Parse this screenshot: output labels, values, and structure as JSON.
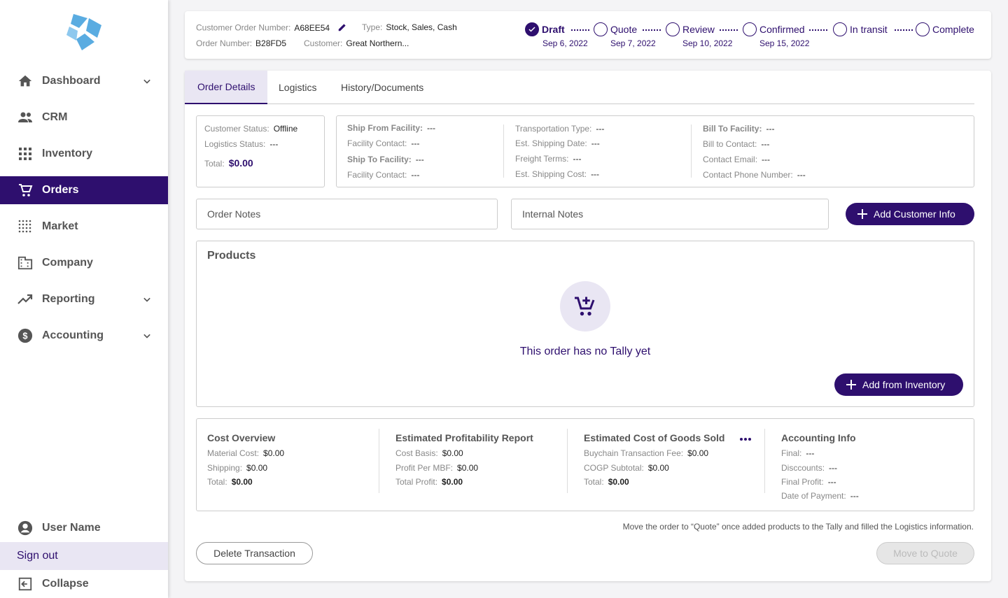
{
  "colors": {
    "brand": "#2e0f6e",
    "accent_bg": "#e9e6f3",
    "logo": "#5aace1"
  },
  "sidebar": {
    "items": [
      {
        "label": "Dashboard",
        "icon": "home-icon",
        "has_chevron": true
      },
      {
        "label": "CRM",
        "icon": "people-icon",
        "has_chevron": false
      },
      {
        "label": "Inventory",
        "icon": "grid-icon",
        "has_chevron": false
      },
      {
        "label": "Orders",
        "icon": "cart-icon",
        "has_chevron": false,
        "active": true
      },
      {
        "label": "Market",
        "icon": "dotgrid-icon",
        "has_chevron": false
      },
      {
        "label": "Company",
        "icon": "building-icon",
        "has_chevron": false
      },
      {
        "label": "Reporting",
        "icon": "trending-icon",
        "has_chevron": true
      },
      {
        "label": "Accounting",
        "icon": "dollar-icon",
        "has_chevron": true
      }
    ],
    "user_name": "User Name",
    "sign_out": "Sign out",
    "collapse": "Collapse"
  },
  "header": {
    "customer_order_number_label": "Customer Order Number:",
    "customer_order_number": "A68EE54",
    "type_label": "Type:",
    "type": "Stock, Sales, Cash",
    "order_number_label": "Order Number:",
    "order_number": "B28FD5",
    "customer_label": "Customer:",
    "customer": "Great Northern...",
    "steps": [
      {
        "label": "Draft",
        "date": "Sep 6, 2022",
        "state": "done"
      },
      {
        "label": "Quote",
        "date": "Sep 7, 2022",
        "state": "todo"
      },
      {
        "label": "Review",
        "date": "Sep 10, 2022",
        "state": "todo"
      },
      {
        "label": "Confirmed",
        "date": "Sep 15, 2022",
        "state": "todo"
      },
      {
        "label": "In transit",
        "date": "",
        "state": "todo"
      },
      {
        "label": "Complete",
        "date": "",
        "state": "todo"
      }
    ]
  },
  "tabs": [
    "Order Details",
    "Logistics",
    "History/Documents"
  ],
  "status": {
    "customer_status_label": "Customer Status:",
    "customer_status": "Offline",
    "logistics_status_label": "Logistics Status:",
    "logistics_status": "---",
    "total_label": "Total:",
    "total": "$0.00"
  },
  "logistics": {
    "col1": [
      {
        "label": "Ship From Facility:",
        "value": "---",
        "bold": true
      },
      {
        "label": "Facility Contact:",
        "value": "---",
        "bold": false
      },
      {
        "label": "Ship To Facility:",
        "value": "---",
        "bold": true
      },
      {
        "label": "Facility Contact:",
        "value": "---",
        "bold": false
      }
    ],
    "col2": [
      {
        "label": "Transportation Type:",
        "value": "---"
      },
      {
        "label": "Est. Shipping Date:",
        "value": "---"
      },
      {
        "label": "Freight Terms:",
        "value": "---"
      },
      {
        "label": "Est. Shipping Cost:",
        "value": "---"
      }
    ],
    "col3": [
      {
        "label": "Bill To Facility:",
        "value": "---",
        "bold": true
      },
      {
        "label": "Bill to Contact:",
        "value": "---",
        "bold": false
      },
      {
        "label": "Contact Email:",
        "value": "---",
        "bold": false
      },
      {
        "label": "Contact Phone Number:",
        "value": "---",
        "bold": false
      }
    ]
  },
  "notes": {
    "order_notes": "Order Notes",
    "internal_notes": "Internal Notes",
    "add_customer_info": "Add Customer Info"
  },
  "products": {
    "title": "Products",
    "empty_message": "This order has no Tally yet",
    "add_button": "Add from Inventory"
  },
  "summary": {
    "cost_overview": {
      "title": "Cost Overview",
      "rows": [
        {
          "label": "Material Cost:",
          "value": "$0.00",
          "bold": false
        },
        {
          "label": "Shipping:",
          "value": "$0.00",
          "bold": false
        },
        {
          "label": "Total:",
          "value": "$0.00",
          "bold": true
        }
      ]
    },
    "profitability": {
      "title": "Estimated Profitability Report",
      "rows": [
        {
          "label": "Cost Basis:",
          "value": "$0.00",
          "bold": false
        },
        {
          "label": "Profit Per MBF:",
          "value": "$0.00",
          "bold": false
        },
        {
          "label": "Total Profit:",
          "value": "$0.00",
          "bold": true
        }
      ]
    },
    "cogs": {
      "title": "Estimated Cost of Goods Sold",
      "rows": [
        {
          "label": "Buychain Transaction Fee:",
          "value": "$0.00",
          "bold": false
        },
        {
          "label": "COGP Subtotal:",
          "value": "$0.00",
          "bold": false
        },
        {
          "label": "Total:",
          "value": "$0.00",
          "bold": true
        }
      ]
    },
    "accounting": {
      "title": "Accounting Info",
      "rows": [
        {
          "label": "Final:",
          "value": "---",
          "bold": false
        },
        {
          "label": "Disccounts:",
          "value": "---",
          "bold": false
        },
        {
          "label": "Final Profit:",
          "value": "---",
          "bold": false
        },
        {
          "label": "Date of Payment:",
          "value": "---",
          "bold": false
        }
      ]
    }
  },
  "footer": {
    "hint": "Move the order to “Quote” once added products to the Tally and filled the Logistics information.",
    "delete_button": "Delete Transaction",
    "move_button": "Move to Quote"
  }
}
